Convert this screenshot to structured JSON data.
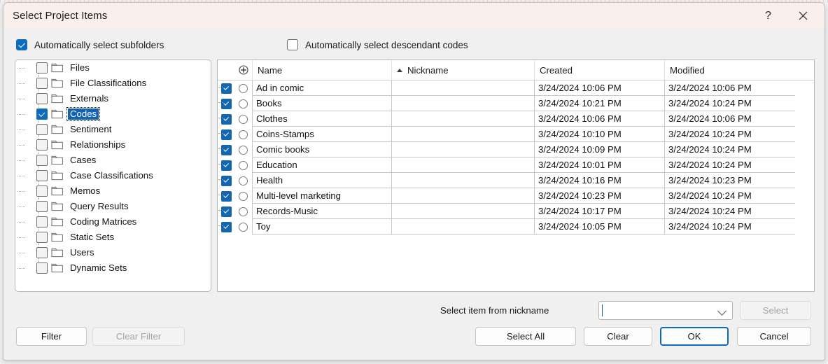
{
  "window": {
    "title": "Select Project Items",
    "help_icon": "question-mark-icon",
    "close_icon": "close-x-icon"
  },
  "options": {
    "subfolders": {
      "label": "Automatically select subfolders",
      "checked": true
    },
    "descendant_codes": {
      "label": "Automatically select descendant codes",
      "checked": false
    }
  },
  "tree": {
    "items": [
      {
        "label": "Files",
        "checked": false,
        "selected": false
      },
      {
        "label": "File Classifications",
        "checked": false,
        "selected": false
      },
      {
        "label": "Externals",
        "checked": false,
        "selected": false
      },
      {
        "label": "Codes",
        "checked": true,
        "selected": true
      },
      {
        "label": "Sentiment",
        "checked": false,
        "selected": false
      },
      {
        "label": "Relationships",
        "checked": false,
        "selected": false
      },
      {
        "label": "Cases",
        "checked": false,
        "selected": false
      },
      {
        "label": "Case Classifications",
        "checked": false,
        "selected": false
      },
      {
        "label": "Memos",
        "checked": false,
        "selected": false
      },
      {
        "label": "Query Results",
        "checked": false,
        "selected": false
      },
      {
        "label": "Coding Matrices",
        "checked": false,
        "selected": false
      },
      {
        "label": "Static Sets",
        "checked": false,
        "selected": false
      },
      {
        "label": "Users",
        "checked": false,
        "selected": false
      },
      {
        "label": "Dynamic Sets",
        "checked": false,
        "selected": false
      }
    ]
  },
  "grid": {
    "columns": {
      "icon_header": "circle-plus-icon",
      "name": "Name",
      "nickname": "Nickname",
      "created": "Created",
      "modified": "Modified"
    },
    "sort": {
      "column": "Nickname",
      "direction": "ascending"
    },
    "rows": [
      {
        "checked": true,
        "name": "Ad in comic",
        "nickname": "",
        "created": "3/24/2024 10:06 PM",
        "modified": "3/24/2024 10:06 PM"
      },
      {
        "checked": true,
        "name": "Books",
        "nickname": "",
        "created": "3/24/2024 10:21 PM",
        "modified": "3/24/2024 10:24 PM"
      },
      {
        "checked": true,
        "name": "Clothes",
        "nickname": "",
        "created": "3/24/2024 10:06 PM",
        "modified": "3/24/2024 10:06 PM"
      },
      {
        "checked": true,
        "name": "Coins-Stamps",
        "nickname": "",
        "created": "3/24/2024 10:10 PM",
        "modified": "3/24/2024 10:24 PM"
      },
      {
        "checked": true,
        "name": "Comic books",
        "nickname": "",
        "created": "3/24/2024 10:09 PM",
        "modified": "3/24/2024 10:24 PM"
      },
      {
        "checked": true,
        "name": "Education",
        "nickname": "",
        "created": "3/24/2024 10:01 PM",
        "modified": "3/24/2024 10:24 PM"
      },
      {
        "checked": true,
        "name": "Health",
        "nickname": "",
        "created": "3/24/2024 10:16 PM",
        "modified": "3/24/2024 10:23 PM"
      },
      {
        "checked": true,
        "name": "Multi-level marketing",
        "nickname": "",
        "created": "3/24/2024 10:23 PM",
        "modified": "3/24/2024 10:24 PM"
      },
      {
        "checked": true,
        "name": "Records-Music",
        "nickname": "",
        "created": "3/24/2024 10:17 PM",
        "modified": "3/24/2024 10:24 PM"
      },
      {
        "checked": true,
        "name": "Toy",
        "nickname": "",
        "created": "3/24/2024 10:05 PM",
        "modified": "3/24/2024 10:24 PM"
      }
    ]
  },
  "nickname_selector": {
    "label": "Select item from nickname",
    "value": "",
    "placeholder": "",
    "select_button": {
      "label": "Select",
      "disabled": true
    }
  },
  "buttons": {
    "filter": {
      "label": "Filter",
      "disabled": false
    },
    "clear_filter": {
      "label": "Clear Filter",
      "disabled": true
    },
    "select_all": {
      "label": "Select All",
      "disabled": false
    },
    "clear": {
      "label": "Clear",
      "disabled": false
    },
    "ok": {
      "label": "OK",
      "disabled": false,
      "default": true
    },
    "cancel": {
      "label": "Cancel",
      "disabled": false
    }
  },
  "colors": {
    "titlebar": "#f9f0ec",
    "dialog_bg": "#f0f0f0",
    "accent": "#0f6cbd",
    "selection": "#0f62b5",
    "disabled_text": "#a4a4a4"
  }
}
